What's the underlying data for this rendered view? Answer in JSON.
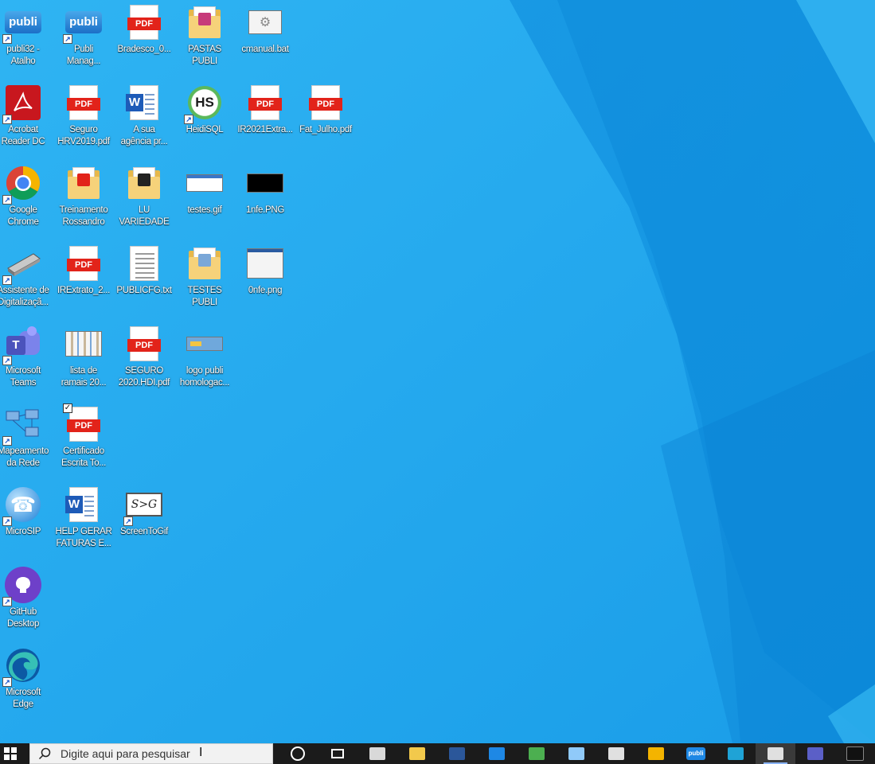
{
  "desktop": {
    "icons": [
      {
        "label": "publi32 -\nAtalho",
        "icon": "publi-icon"
      },
      {
        "label": "Publi\nManag...",
        "icon": "publi-icon"
      },
      {
        "label": "Bradesco_0...",
        "icon": "pdf-file-icon",
        "badge": "PDF"
      },
      {
        "label": "PASTAS\nPUBLI",
        "icon": "folder-icon"
      },
      {
        "label": "cmanual.bat",
        "icon": "batch-file-icon"
      },
      {
        "label": "Acrobat\nReader DC",
        "icon": "acrobat-icon"
      },
      {
        "label": "Seguro\nHRV2019.pdf",
        "icon": "pdf-file-icon",
        "badge": "PDF"
      },
      {
        "label": "A sua\nagência pr...",
        "icon": "word-doc-icon",
        "badge": "W"
      },
      {
        "label": "HeidiSQL",
        "icon": "heidisql-icon",
        "badge": "HS"
      },
      {
        "label": "IR2021Extra...",
        "icon": "pdf-file-icon",
        "badge": "PDF"
      },
      {
        "label": "Fat_Julho.pdf",
        "icon": "pdf-file-icon",
        "badge": "PDF"
      },
      {
        "label": "Google\nChrome",
        "icon": "chrome-icon"
      },
      {
        "label": "Treinamento\nRossandro",
        "icon": "folder-icon"
      },
      {
        "label": "LU\nVARIEDADE",
        "icon": "folder-icon"
      },
      {
        "label": "testes.gif",
        "icon": "gif-file-icon"
      },
      {
        "label": "1nfe.PNG",
        "icon": "png-file-icon"
      },
      {
        "label": "Assistente de\nDigitalizaçã...",
        "icon": "scanner-icon"
      },
      {
        "label": "IRExtrato_2...",
        "icon": "pdf-file-icon",
        "badge": "PDF"
      },
      {
        "label": "PUBLICFG.txt",
        "icon": "text-file-icon"
      },
      {
        "label": "TESTES PUBLI",
        "icon": "folder-icon"
      },
      {
        "label": "0nfe.png",
        "icon": "png-file-icon"
      },
      {
        "label": "Microsoft\nTeams",
        "icon": "teams-icon",
        "badge": "T"
      },
      {
        "label": "lista de\nramais 20...",
        "icon": "image-file-icon"
      },
      {
        "label": "SEGURO\n2020.HDI.pdf",
        "icon": "pdf-file-icon",
        "badge": "PDF"
      },
      {
        "label": "logo publi\nhomologac...",
        "icon": "image-file-icon"
      },
      {
        "label": "Mapeamento\nda Rede",
        "icon": "network-map-icon"
      },
      {
        "label": "Certificado\nEscrita To...",
        "icon": "pdf-file-icon",
        "badge": "PDF"
      },
      {
        "label": "MicroSIP",
        "icon": "microsip-icon"
      },
      {
        "label": "HELP GERAR\nFATURAS E...",
        "icon": "word-doc-icon",
        "badge": "W"
      },
      {
        "label": "ScreenToGif",
        "icon": "screentogif-icon",
        "badge": "S>G"
      },
      {
        "label": "GitHub\nDesktop",
        "icon": "github-icon"
      },
      {
        "label": "Microsoft\nEdge",
        "icon": "edge-icon"
      }
    ]
  },
  "taskbar": {
    "search_placeholder": "Digite aqui para pesquisar",
    "apps": [
      {
        "name": "cortana-icon",
        "color": "#ffffff"
      },
      {
        "name": "task-view-icon",
        "color": "#ffffff"
      },
      {
        "name": "file-cabinet-icon",
        "color": "#d9d9d9"
      },
      {
        "name": "file-explorer-icon",
        "color": "#f2c94c"
      },
      {
        "name": "word-icon",
        "color": "#2b579a"
      },
      {
        "name": "mail-icon",
        "color": "#1e88e5"
      },
      {
        "name": "chrome-icon",
        "color": "#4caf50"
      },
      {
        "name": "pen-tool-icon",
        "color": "#90caf9"
      },
      {
        "name": "satellite-icon",
        "color": "#e0e0e0"
      },
      {
        "name": "paint-icon",
        "color": "#f4b400"
      },
      {
        "name": "publi-icon",
        "color": "#1e88e5",
        "text": "publi"
      },
      {
        "name": "edge-icon",
        "color": "#1fa3d6"
      },
      {
        "name": "screen-icon",
        "color": "#e0e0e0"
      },
      {
        "name": "teams-icon",
        "color": "#5b5fc7"
      },
      {
        "name": "terminal-icon",
        "color": "#111111"
      }
    ]
  },
  "colors": {
    "wallpaper": "#1aa3ea",
    "taskbar": "#1b1b1b",
    "pdf_red": "#e2231a",
    "word_blue": "#1e5bb8"
  }
}
